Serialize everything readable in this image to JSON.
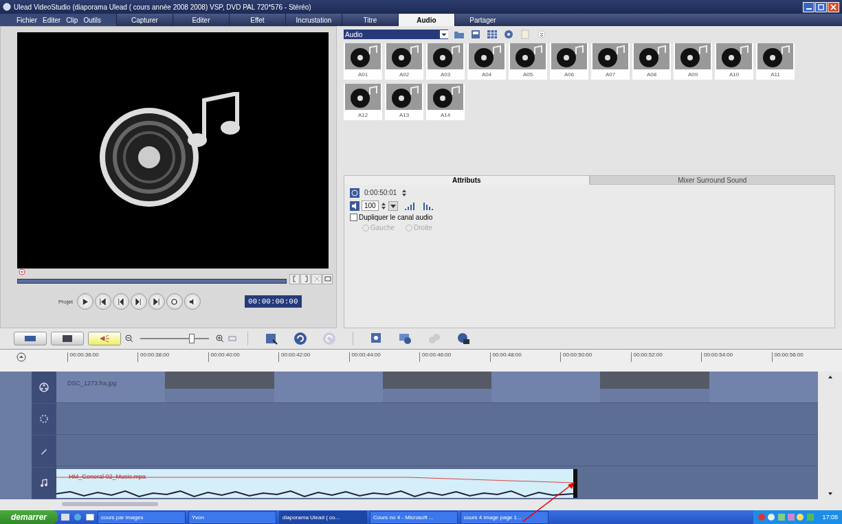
{
  "window": {
    "title": "Ulead VideoStudio (diaporama Ulead ( cours année 2008 2008) VSP, DVD PAL 720*576 - Stéréo)"
  },
  "menu": [
    "Fichier",
    "Editer",
    "Clip",
    "Outils"
  ],
  "tabs": [
    {
      "label": "Capturer",
      "selected": false
    },
    {
      "label": "Editer",
      "selected": false
    },
    {
      "label": "Effet",
      "selected": false
    },
    {
      "label": "Incrustation",
      "selected": false
    },
    {
      "label": "Titre",
      "selected": false
    },
    {
      "label": "Audio",
      "selected": true
    },
    {
      "label": "Partager",
      "selected": false
    }
  ],
  "library": {
    "dropdown": "Audio",
    "items": [
      {
        "label": "A01"
      },
      {
        "label": "A02"
      },
      {
        "label": "A03"
      },
      {
        "label": "A04"
      },
      {
        "label": "A05"
      },
      {
        "label": "A06"
      },
      {
        "label": "A07"
      },
      {
        "label": "A08"
      },
      {
        "label": "A09"
      },
      {
        "label": "A10"
      },
      {
        "label": "A11"
      },
      {
        "label": "A12"
      },
      {
        "label": "A13"
      },
      {
        "label": "A14"
      }
    ]
  },
  "player": {
    "project_label": "Projet",
    "timecode": "00:00:00:00"
  },
  "attributes": {
    "tabs": [
      {
        "label": "Attributs",
        "selected": true
      },
      {
        "label": "Mixer Surround Sound",
        "selected": false
      }
    ],
    "duration": "0:00:50:01",
    "volume": "100",
    "duplicate": {
      "label": "Dupliquer le canal audio",
      "checked": false
    },
    "channels": [
      {
        "label": "Gauche",
        "selected": false,
        "disabled": true
      },
      {
        "label": "Droite",
        "selected": false,
        "disabled": true
      }
    ]
  },
  "toolbar": {
    "zoom": {
      "level": 0.75
    }
  },
  "timeline": {
    "ruler": [
      "00:00:36:00",
      "00:00:38:00",
      "00:00:40:00",
      "00:00:42:00",
      "00:00:44:00",
      "00:00:46:00",
      "00:00:48:00",
      "00:00:50:00",
      "00:00:52:00",
      "00:00:54:00",
      "00:00:56:00"
    ],
    "video_segments": [
      {
        "kind": "photo",
        "label": "DSC_1273.fra.jpg"
      },
      {
        "kind": "transition"
      },
      {
        "kind": "photo"
      },
      {
        "kind": "transition"
      },
      {
        "kind": "photo"
      },
      {
        "kind": "transition"
      },
      {
        "kind": "photo"
      }
    ],
    "music_clip": {
      "label": "HM_General 02_Music.mpa"
    }
  },
  "taskbar": {
    "start": "demarrer",
    "tasks": [
      {
        "label": "cours par images",
        "selected": false
      },
      {
        "label": "Yvon",
        "selected": false
      },
      {
        "label": "diaporama Ulead ( co...",
        "selected": true
      },
      {
        "label": "Cours no 4 - Microsoft ...",
        "selected": false
      },
      {
        "label": "cours 4 image page 1...",
        "selected": false
      }
    ],
    "clock": "17:08"
  }
}
